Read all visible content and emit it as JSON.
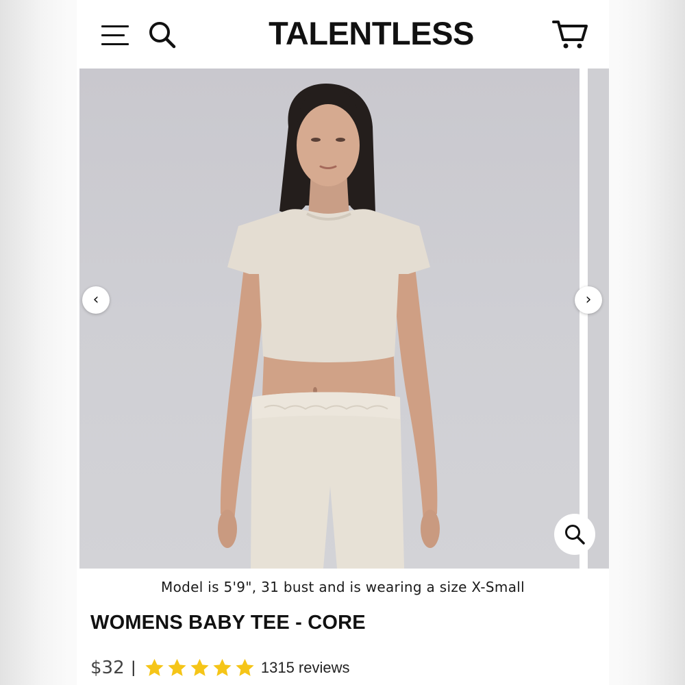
{
  "header": {
    "brand": "TALENTLESS",
    "menu_icon": "hamburger-menu-icon",
    "search_icon": "search-icon",
    "cart_icon": "cart-icon"
  },
  "gallery": {
    "prev_icon": "chevron-left-icon",
    "next_icon": "chevron-right-icon",
    "prev_glyph": "‹",
    "next_glyph": "›",
    "zoom_icon": "magnify-icon"
  },
  "product": {
    "model_caption": "Model is 5'9\", 31 bust and is wearing a size X-Small",
    "title": "WOMENS BABY TEE - CORE",
    "price": "$32",
    "separator": "|",
    "rating": 5,
    "rating_max": 5,
    "reviews": "1315 reviews"
  },
  "colors": {
    "star": "#f5c518",
    "text": "#111111",
    "background": "#ffffff"
  }
}
